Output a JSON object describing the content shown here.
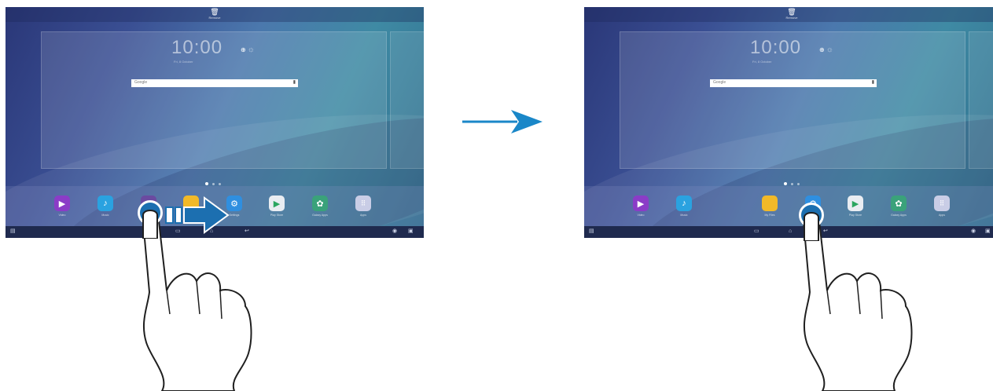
{
  "screens": [
    {
      "remove_label": "Remove",
      "clock": "10:00",
      "date": "Fri, 8 October",
      "search_placeholder": "Google",
      "apps": [
        {
          "name": "Video",
          "icon": "play-icon",
          "color": "#8b3cc7",
          "glyph": "▶"
        },
        {
          "name": "Music",
          "icon": "music-note-icon",
          "color": "#2aa2e0",
          "glyph": "♪"
        },
        {
          "name": "My Files",
          "icon": "folder-icon",
          "color": "#f2b928",
          "glyph": ""
        },
        {
          "name": "Settings",
          "icon": "gear-icon",
          "color": "#2f8fe0",
          "glyph": "⚙"
        },
        {
          "name": "Play Store",
          "icon": "play-store-icon",
          "color": "#e9edf2",
          "glyph": "▶"
        },
        {
          "name": "Galaxy Apps",
          "icon": "galaxy-apps-icon",
          "color": "#3aa27a",
          "glyph": "✿"
        },
        {
          "name": "Apps",
          "icon": "apps-grid-icon",
          "color": "#c9cde6",
          "glyph": "⋮⋮"
        }
      ]
    },
    {
      "remove_label": "Remove",
      "clock": "10:00",
      "date": "Fri, 8 October",
      "search_placeholder": "Google",
      "apps": [
        {
          "name": "Video",
          "icon": "play-icon",
          "color": "#8b3cc7",
          "glyph": "▶"
        },
        {
          "name": "Music",
          "icon": "music-note-icon",
          "color": "#2aa2e0",
          "glyph": "♪"
        },
        {
          "name": "My Files",
          "icon": "folder-icon",
          "color": "#f2b928",
          "glyph": ""
        },
        {
          "name": "Settings",
          "icon": "gear-icon",
          "color": "#2f8fe0",
          "glyph": "⚙"
        },
        {
          "name": "Play Store",
          "icon": "play-store-icon",
          "color": "#e9edf2",
          "glyph": "▶"
        },
        {
          "name": "Galaxy Apps",
          "icon": "galaxy-apps-icon",
          "color": "#3aa27a",
          "glyph": "✿"
        },
        {
          "name": "Apps",
          "icon": "apps-grid-icon",
          "color": "#c9cde6",
          "glyph": "⋮⋮"
        }
      ]
    }
  ],
  "colors": {
    "transition_arrow": "#1a87c8",
    "drag_arrow": "#1c6fb0",
    "touch_point": "#1c6fb0"
  }
}
